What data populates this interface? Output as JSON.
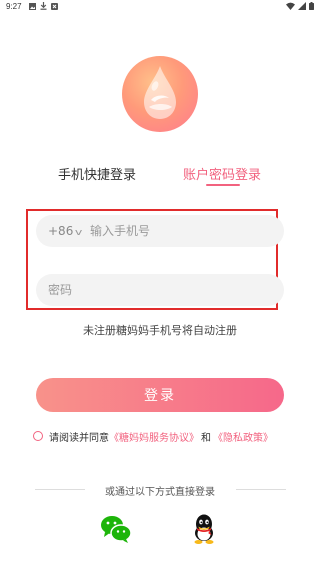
{
  "status_bar": {
    "time": "9:27",
    "left_icons": [
      "image-icon",
      "download-icon",
      "notification-icon"
    ],
    "right_icons": [
      "wifi-icon",
      "signal-icon",
      "battery-icon"
    ]
  },
  "logo": {
    "icon": "water-drop-logo"
  },
  "tabs": [
    {
      "label": "手机快捷登录",
      "active": false
    },
    {
      "label": "账户密码登录",
      "active": true
    }
  ],
  "form": {
    "country_code": "+86",
    "phone_placeholder": "输入手机号",
    "password_placeholder": "密码"
  },
  "hint": "未注册糖妈妈手机号将自动注册",
  "login_button": "登录",
  "agreement": {
    "prefix": "请阅读并同意",
    "terms_link": "《糖妈妈服务协议》",
    "conjunction": "和",
    "privacy_link": "《隐私政策》"
  },
  "alt_login": {
    "label": "或通过以下方式直接登录",
    "providers": [
      "wechat-icon",
      "qq-icon"
    ]
  },
  "colors": {
    "accent": "#f2627f",
    "button_start": "#f8928a",
    "button_end": "#f6688a",
    "highlight_box": "#e12b2b"
  }
}
